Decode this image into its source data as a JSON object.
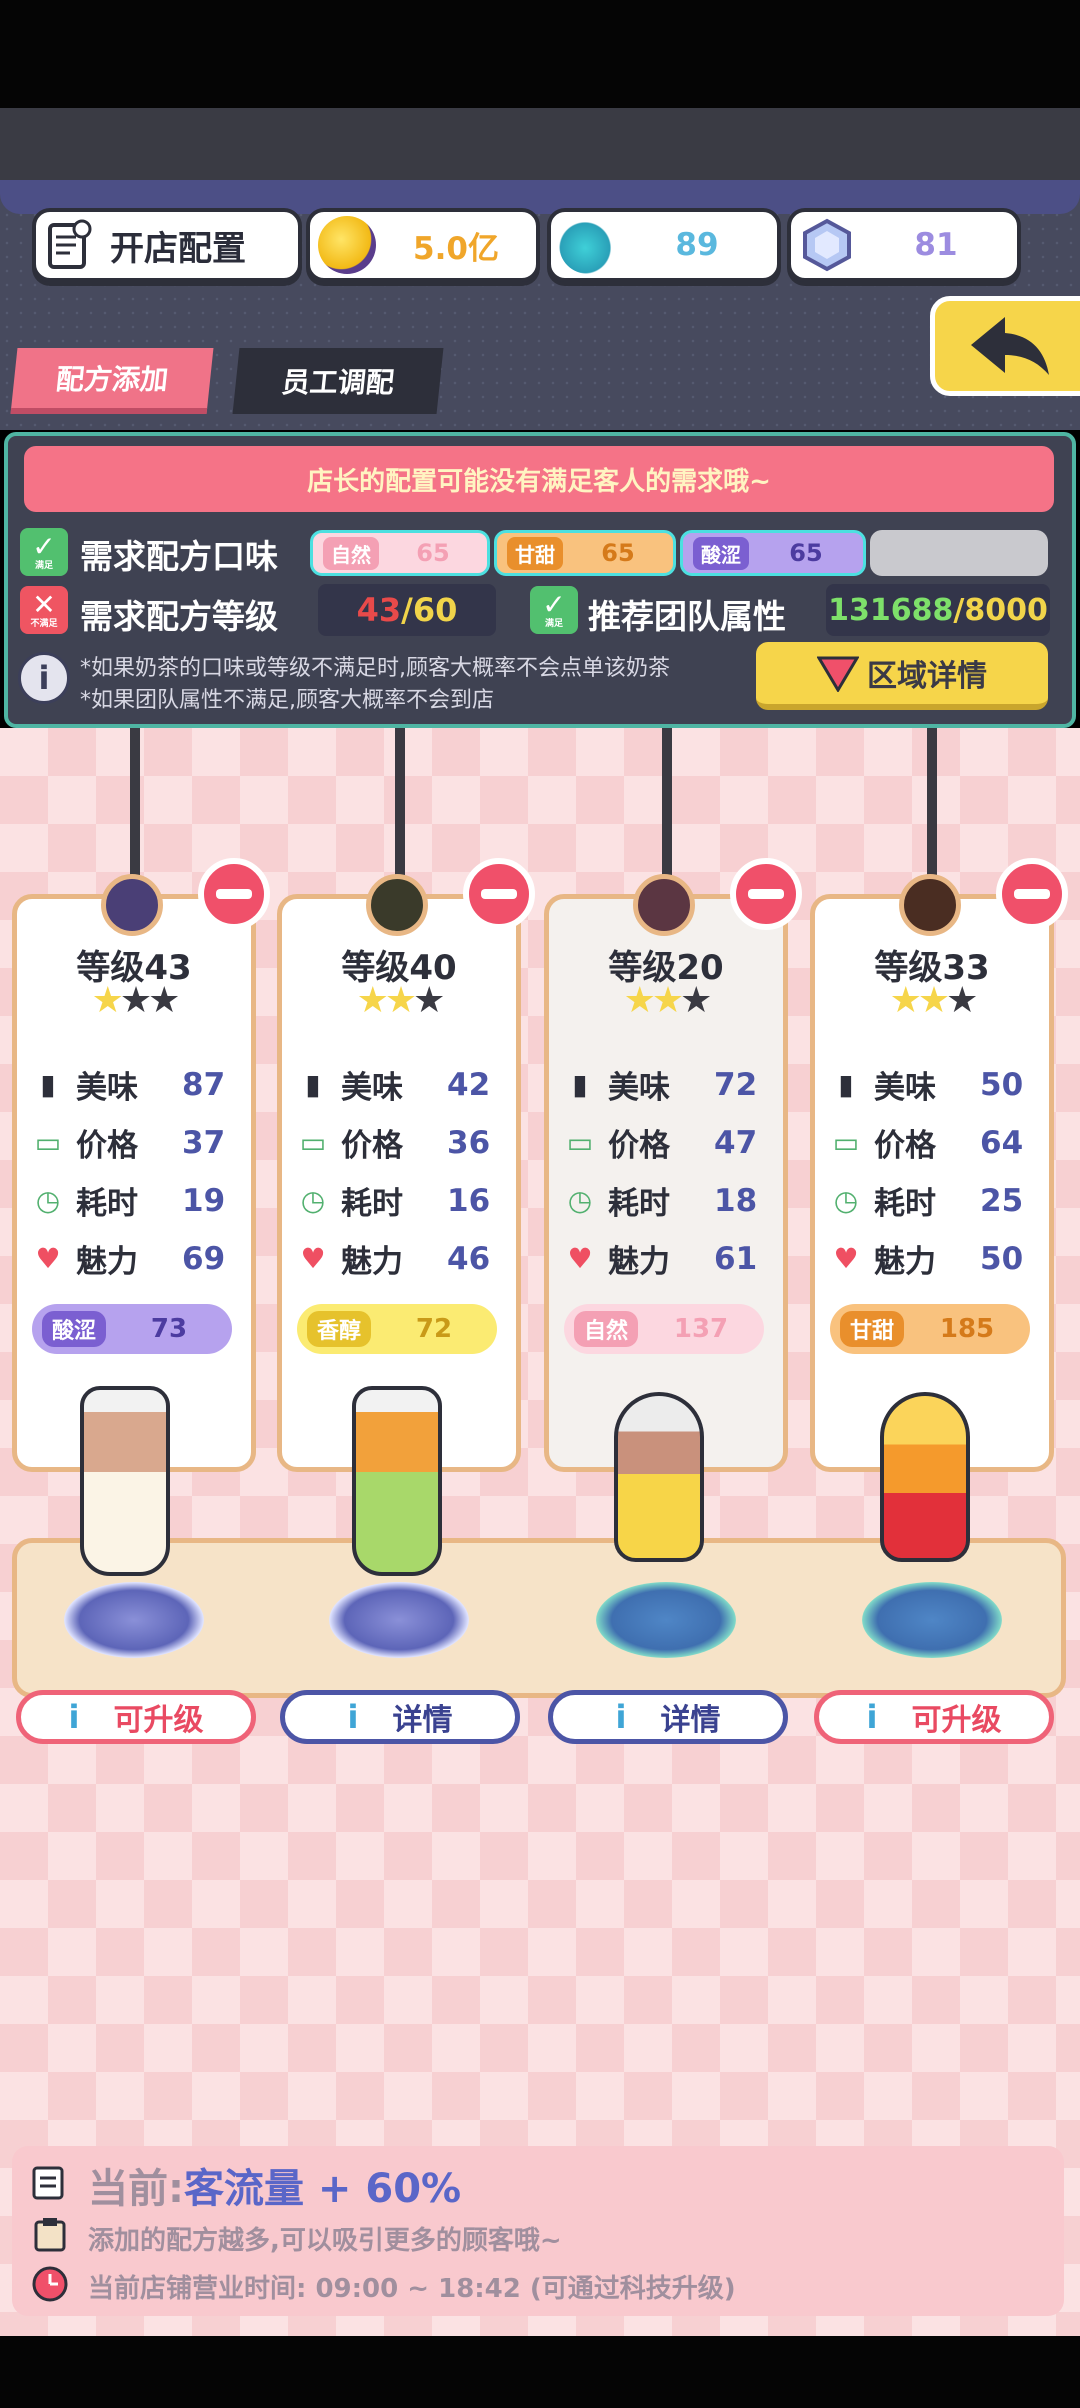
{
  "header": {
    "shop_config_label": "开店配置",
    "coins": "5.0亿",
    "potion": "89",
    "gems": "81"
  },
  "tabs": [
    {
      "label": "配方添加",
      "active": true
    },
    {
      "label": "员工调配",
      "active": false
    }
  ],
  "requirements": {
    "warning": "店长的配置可能没有满足客人的需求哦~",
    "flavor_label": "需求配方口味",
    "flavor_ok_mark": "满足",
    "flavors": [
      {
        "name": "自然",
        "value": "65"
      },
      {
        "name": "甘甜",
        "value": "65"
      },
      {
        "name": "酸涩",
        "value": "65"
      }
    ],
    "level_label": "需求配方等级",
    "level_bad_mark": "不满足",
    "level_current": "43",
    "level_target": "/60",
    "team_label": "推荐团队属性",
    "team_ok_mark": "满足",
    "team_current": "131688",
    "team_target": "/8000",
    "note1": "*如果奶茶的口味或等级不满足时,顾客大概率不会点单该奶茶",
    "note2": "*如果团队属性不满足,顾客大概率不会到店",
    "region_button": "区域详情"
  },
  "recipes": [
    {
      "level": "等级43",
      "stars": 1,
      "taste": "87",
      "price": "37",
      "time": "19",
      "charm": "69",
      "flavor": "酸涩",
      "flavor_value": "73",
      "button": "可升级"
    },
    {
      "level": "等级40",
      "stars": 2,
      "taste": "42",
      "price": "36",
      "time": "16",
      "charm": "46",
      "flavor": "香醇",
      "flavor_value": "72",
      "button": "详情"
    },
    {
      "level": "等级20",
      "stars": 2,
      "taste": "72",
      "price": "47",
      "time": "18",
      "charm": "61",
      "flavor": "自然",
      "flavor_value": "137",
      "button": "详情"
    },
    {
      "level": "等级33",
      "stars": 2,
      "taste": "50",
      "price": "64",
      "time": "25",
      "charm": "50",
      "flavor": "甘甜",
      "flavor_value": "185",
      "button": "可升级"
    }
  ],
  "stat_labels": {
    "taste": "美味",
    "price": "价格",
    "time": "耗时",
    "charm": "魅力"
  },
  "bottom": {
    "current_label": "当前:",
    "current_value": "客流量 + 60%",
    "tip": "添加的配方越多,可以吸引更多的顾客哦~",
    "hours": "当前店铺营业时间: 09:00 ~ 18:42 (可通过科技升级)"
  },
  "colors": {
    "accent_pink": "#f07388",
    "gold": "#f6d54a",
    "sour": "#7b5fd1",
    "sweet": "#f0a046",
    "natural": "#f4a0b4",
    "mellow": "#e6c22c"
  }
}
